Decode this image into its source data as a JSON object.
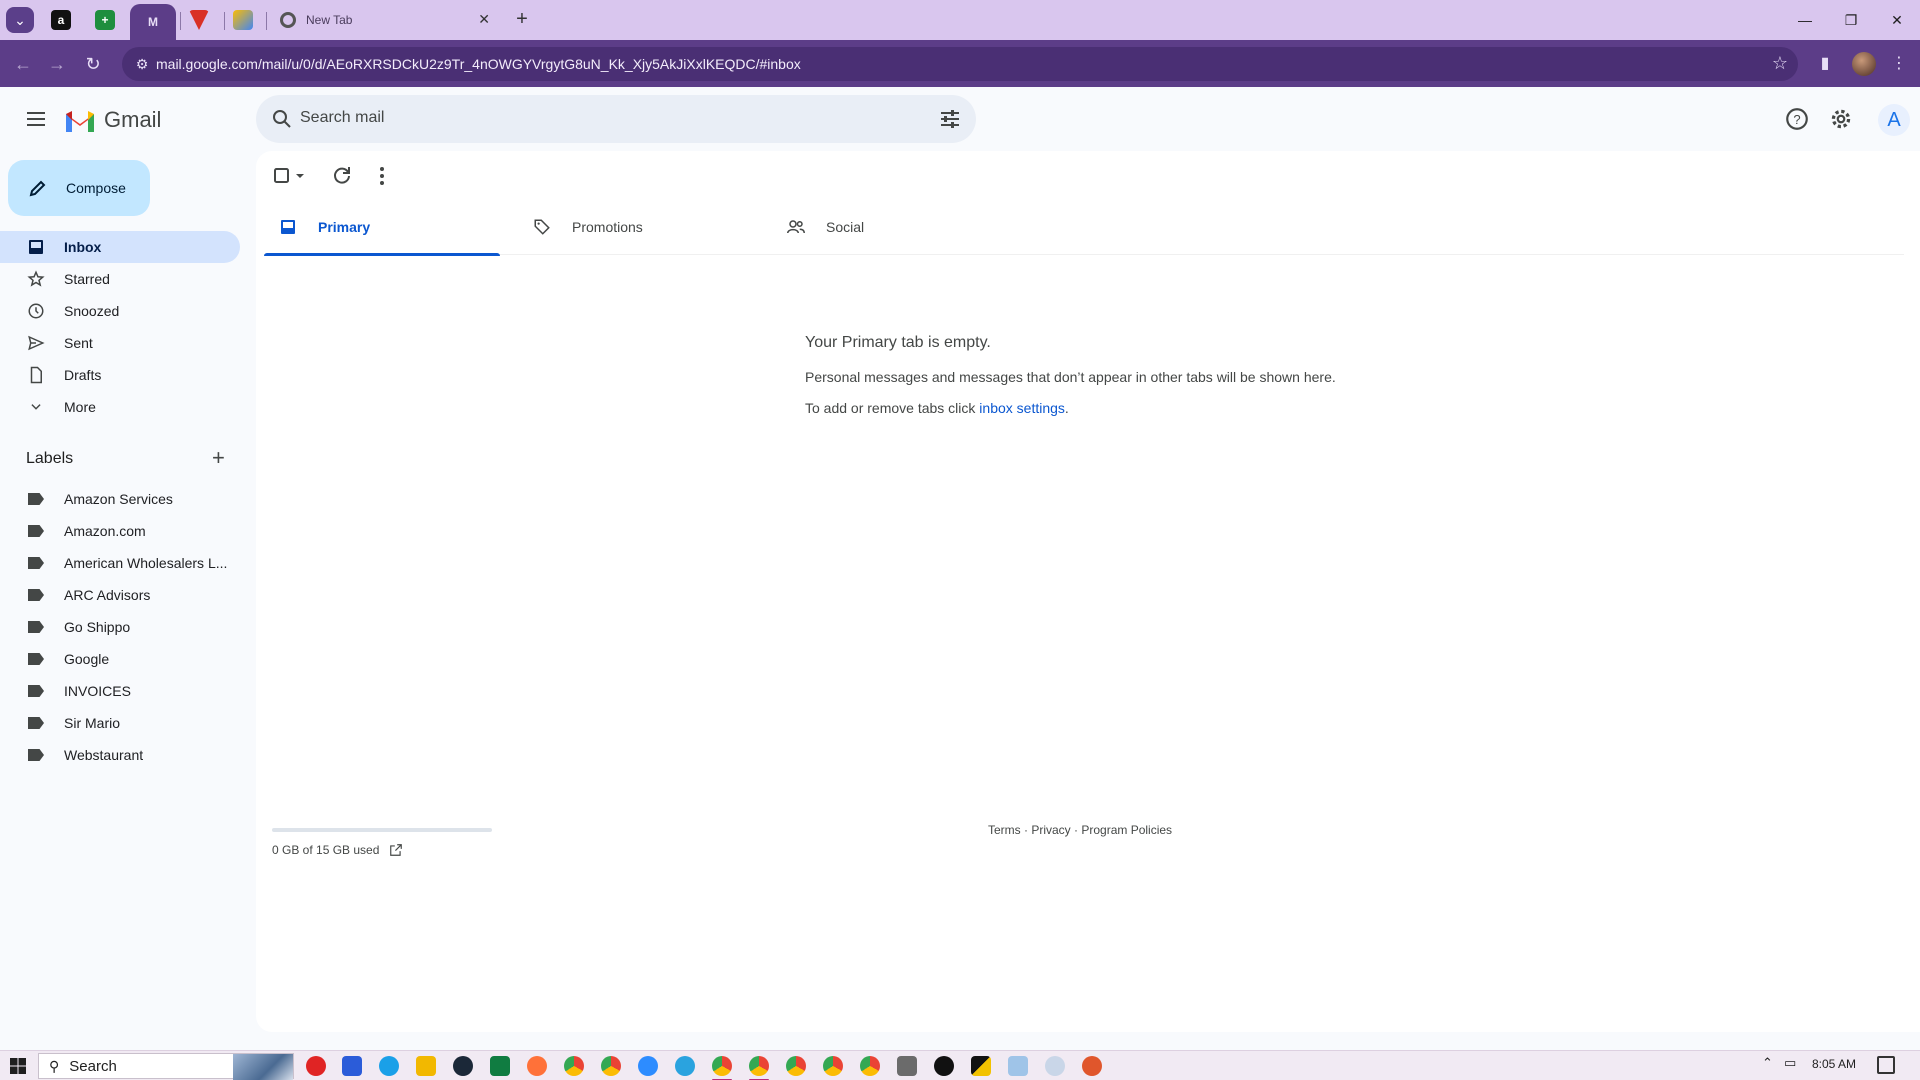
{
  "browser": {
    "tabs": [
      {
        "name": "amazon-tab",
        "glyph": "a",
        "color": "#111111"
      },
      {
        "name": "sheets-tab",
        "glyph": "+",
        "color": "#1e8e3e"
      },
      {
        "name": "gmail-tab",
        "glyph": "M",
        "color": "#8a5cc4"
      },
      {
        "name": "vivaldi-tab",
        "glyph": "V",
        "color": "#d93025"
      },
      {
        "name": "pen-tab",
        "glyph": "/",
        "color": "#4285f4"
      }
    ],
    "new_tab_label": "New Tab",
    "url": "mail.google.com/mail/u/0/d/AEoRXRSDCkU2z9Tr_4nOWGYVrgytG8uN_Kk_Xjy5AkJiXxlKEQDC/#inbox"
  },
  "gmail": {
    "logo_text": "Gmail",
    "search_placeholder": "Search mail",
    "avatar_letter": "A",
    "compose_label": "Compose",
    "nav": [
      {
        "label": "Inbox",
        "icon": "inbox-icon",
        "active": true
      },
      {
        "label": "Starred",
        "icon": "star-icon"
      },
      {
        "label": "Snoozed",
        "icon": "clock-icon"
      },
      {
        "label": "Sent",
        "icon": "send-icon"
      },
      {
        "label": "Drafts",
        "icon": "draft-icon"
      },
      {
        "label": "More",
        "icon": "chevron-down-icon"
      }
    ],
    "labels_heading": "Labels",
    "labels": [
      "Amazon Services",
      "Amazon.com",
      "American Wholesalers L...",
      "ARC Advisors",
      "Go Shippo",
      "Google",
      "INVOICES",
      "Sir Mario",
      "Webstaurant"
    ],
    "tabs": [
      {
        "label": "Primary",
        "icon": "inbox-tab-icon",
        "active": true
      },
      {
        "label": "Promotions",
        "icon": "tag-icon"
      },
      {
        "label": "Social",
        "icon": "people-icon"
      }
    ],
    "empty": {
      "title": "Your Primary tab is empty.",
      "line1": "Personal messages and messages that don’t appear in other tabs will be shown here.",
      "line2_prefix": "To add or remove tabs click ",
      "line2_link": "inbox settings",
      "line2_suffix": "."
    },
    "storage_text": "0 GB of 15 GB used",
    "footer": {
      "terms": "Terms",
      "privacy": "Privacy",
      "policies": "Program Policies",
      "sep": " · "
    }
  },
  "taskbar": {
    "search_label": "Search",
    "time": "8:05 AM"
  },
  "colors": {
    "accent": "#0b57d0",
    "compose_bg": "#c2e7ff",
    "active_nav": "#d3e3fd",
    "browser_frame": "#5c3d88"
  }
}
